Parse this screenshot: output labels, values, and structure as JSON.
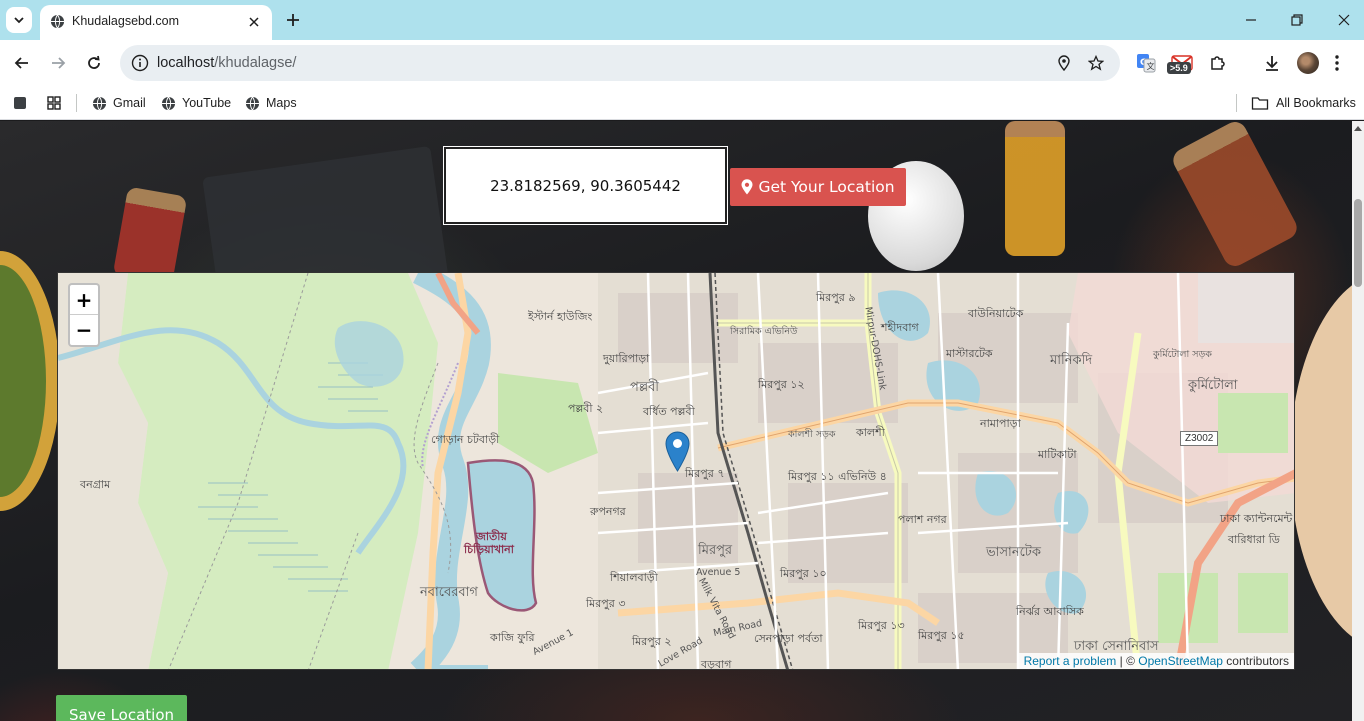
{
  "browser": {
    "tab_title": "Khudalagsebd.com",
    "url_host": "localhost",
    "url_path": "/khudalagse/",
    "extension_badge": ">5.9",
    "bookmarks": [
      "Gmail",
      "YouTube",
      "Maps"
    ],
    "all_bookmarks": "All Bookmarks"
  },
  "page": {
    "coordinates": "23.8182569, 90.3605442",
    "get_location_label": "Get Your Location",
    "save_location_label": "Save Location"
  },
  "map": {
    "zoom_in": "+",
    "zoom_out": "−",
    "attribution_report": "Report a problem",
    "attribution_sep": " | © ",
    "attribution_osm": "OpenStreetMap",
    "attribution_suffix": " contributors",
    "road_code": "Z3002",
    "labels": {
      "eastern_housing": "ইস্টার্ন হাউজিং",
      "mirpur_9": "মিরপুর ৯",
      "shaheedbag": "শহীদবাগ",
      "baunia": "বাউনিয়াটেক",
      "duaripara": "দুয়ারিপাড়া",
      "pallabi": "পল্লবী",
      "pallabi_2": "পল্লবী ২",
      "bardhita_pallabi": "বর্ধিত পল্লবী",
      "mirpur_12": "মিরপুর ১২",
      "mastertek": "মাস্টারটেক",
      "manikdi": "মানিকদি",
      "kurmitola": "কুর্মিটোলা",
      "kurmitola_road": "কুর্মিটোলা সড়ক",
      "namapara": "নামাপাড়া",
      "gorans": "গোড়ান চটবাড়ী",
      "kalshi_road": "কালশী সড়ক",
      "kalshi": "কালশী",
      "matikata": "মাটিকাটা",
      "mirpur_7": "মিরপুর ৭",
      "mirpur_11": "মিরপুর ১১ এভিনিউ ৪",
      "bongram": "বনগ্রাম",
      "rupnagar": "রুপনগর",
      "zoo_1": "জাতীয়",
      "zoo_2": "চিড়িয়াখানা",
      "polash_nagar": "পলাশ নগর",
      "dhaka_cantonment": "ঢাকা ক্যান্টনমেন্ট",
      "baridhara": "বারিধারা ডি",
      "mirpur": "মিরপুর",
      "bhashantek": "ভাসানটেক",
      "siyalbari": "শিয়ালবাড়ী",
      "avenue_5": "Avenue 5",
      "mirpur_10": "মিরপুর ১০",
      "nababerbag": "নবাবেরবাগ",
      "mirpur_3": "মিরপুর ৩",
      "milk_vita_road": "Milk Vita Road",
      "nirjhar": "নির্ঝর আবাসিক",
      "kazi_furi": "কাজি ফুরি",
      "avenue_1": "Avenue 1",
      "mirpur_2": "মিরপুর ২",
      "love_road": "Love Road",
      "main_road": "Main Road",
      "senpara": "সেনপাড়া পর্বতা",
      "mirpur_13": "মিরপুর ১৩",
      "mirpur_15": "মিরপুর ১৫",
      "dhaka_senanibas": "ঢাকা সেনানিবাস",
      "sarak_avenue": "সিরামিক এভিনিউ",
      "barabag": "বড়বাগ",
      "mirpur_dohs": "Mirpur-DOHS-Link"
    }
  }
}
